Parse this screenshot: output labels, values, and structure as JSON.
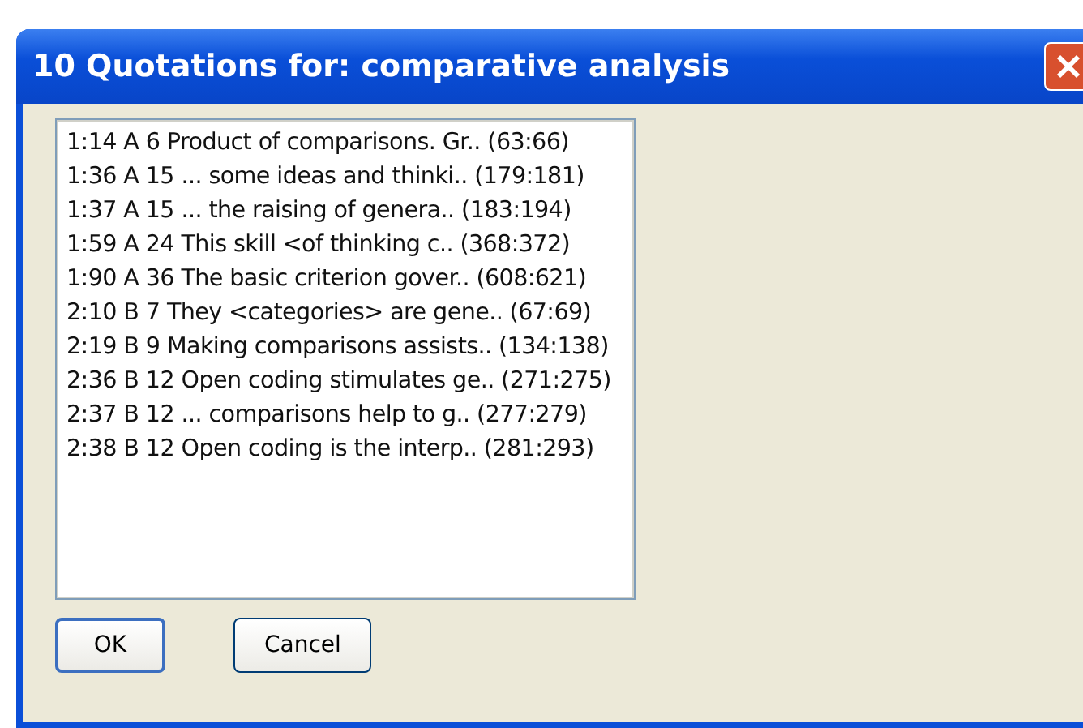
{
  "window": {
    "title": "10 Quotations for: comparative analysis"
  },
  "quotations": [
    "1:14 A 6 Product of comparisons. Gr.. (63:66)",
    "1:36 A 15 ... some ideas and thinki.. (179:181)",
    "1:37 A 15 ... the raising of genera.. (183:194)",
    "1:59 A 24 This skill <of thinking c.. (368:372)",
    "1:90 A 36 The basic criterion gover.. (608:621)",
    "2:10 B 7 They <categories> are gene.. (67:69)",
    "2:19 B 9 Making comparisons assists.. (134:138)",
    "2:36 B 12 Open coding stimulates ge.. (271:275)",
    "2:37 B 12 ... comparisons help to g.. (277:279)",
    "2:38 B 12 Open coding is the interp.. (281:293)"
  ],
  "buttons": [
    {
      "label": "OK",
      "default": true
    },
    {
      "label": "Cancel",
      "default": false
    }
  ]
}
